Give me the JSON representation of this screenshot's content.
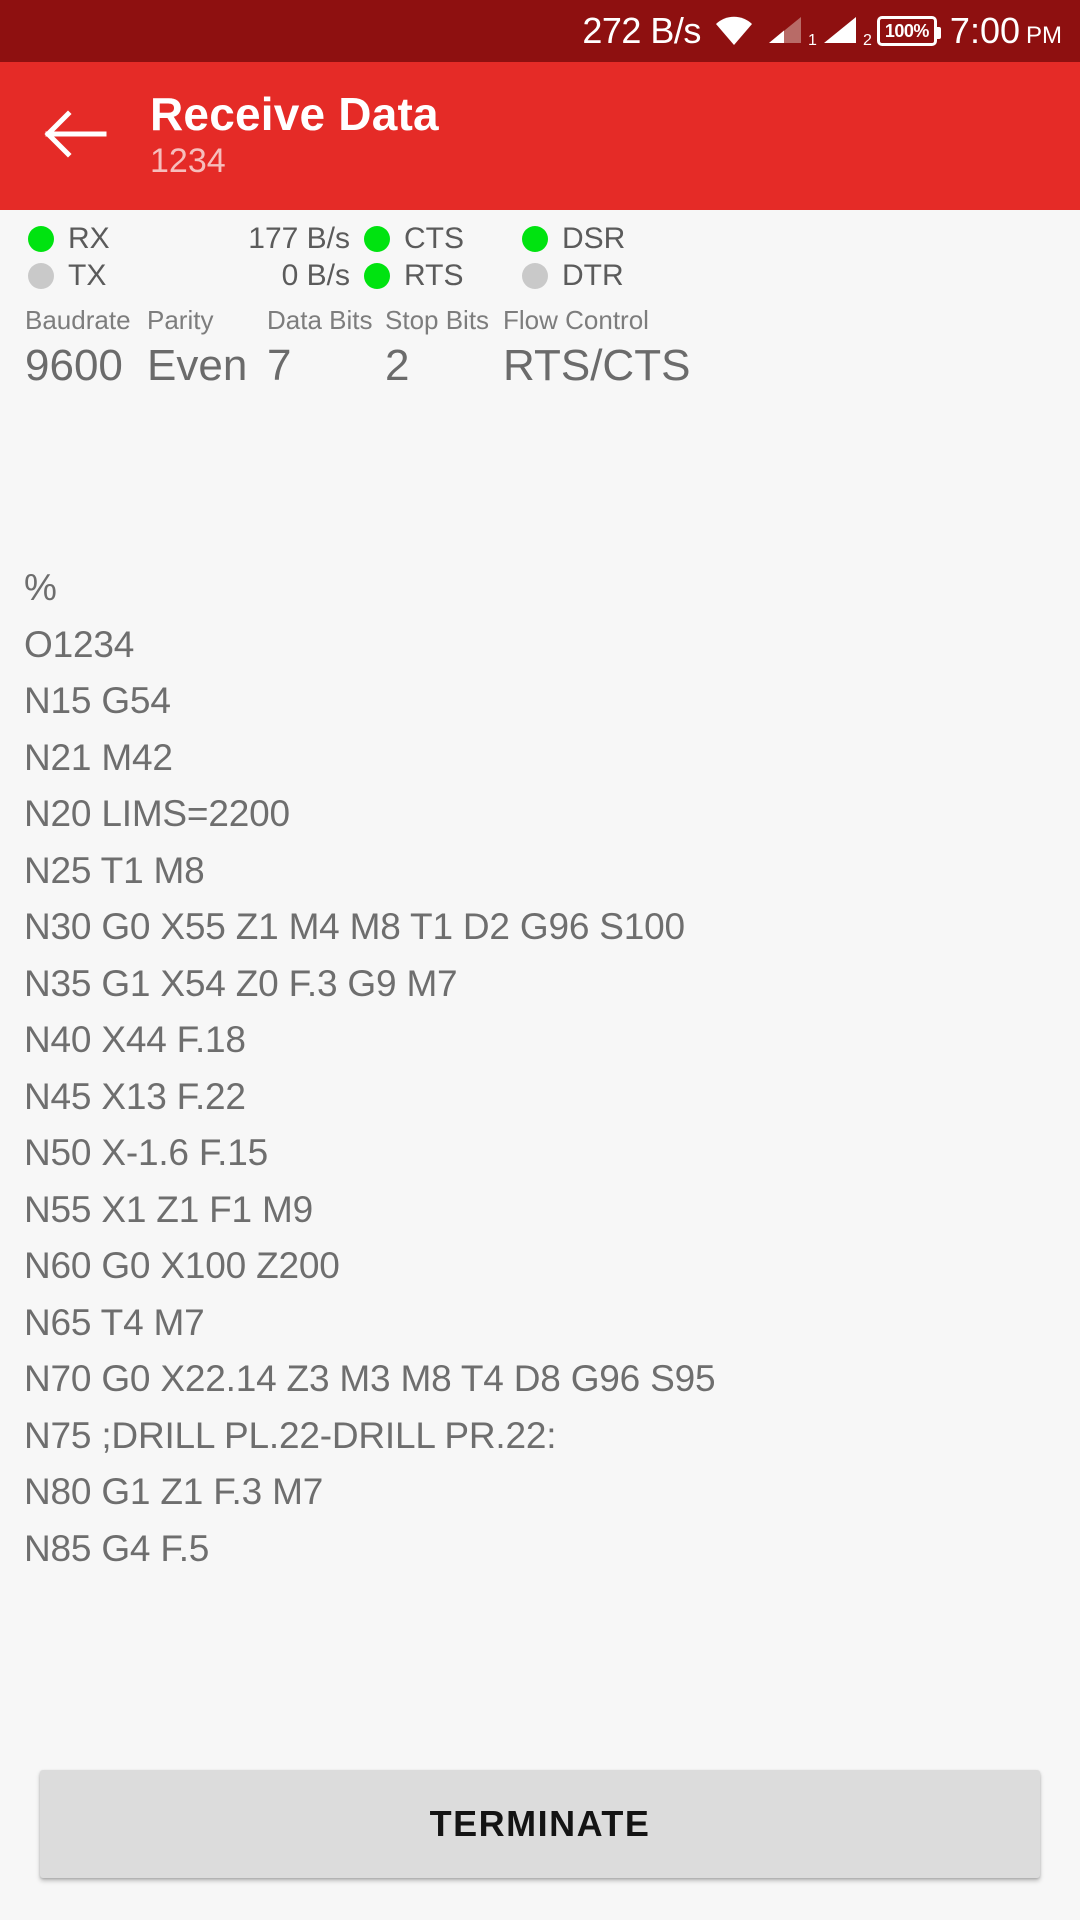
{
  "statusbar": {
    "net_speed": "272 B/s",
    "wifi_icon": "wifi-icon",
    "sim1_icon": "signal-sim1-icon",
    "sim1_label": "1",
    "sim2_icon": "signal-sim2-icon",
    "sim2_label": "2",
    "battery_text": "100%",
    "time": "7:00",
    "ampm": "PM"
  },
  "appbar": {
    "back_icon": "back-arrow-icon",
    "title": "Receive Data",
    "subtitle": "1234",
    "bg_color": "#E52B27"
  },
  "indicators": {
    "colors": {
      "on": "#00E310",
      "off": "#C9C9C9"
    },
    "rows": [
      {
        "signal_label": "RX",
        "signal_state": "on",
        "rate": "177 B/s",
        "mid_label": "CTS",
        "mid_state": "on",
        "end_label": "DSR",
        "end_state": "on"
      },
      {
        "signal_label": "TX",
        "signal_state": "off",
        "rate": "0 B/s",
        "mid_label": "RTS",
        "mid_state": "on",
        "end_label": "DTR",
        "end_state": "off"
      }
    ]
  },
  "settings": [
    {
      "label": "Baudrate",
      "value": "9600"
    },
    {
      "label": "Parity",
      "value": "Even"
    },
    {
      "label": "Data Bits",
      "value": "7"
    },
    {
      "label": "Stop Bits",
      "value": "2"
    },
    {
      "label": "Flow Control",
      "value": "RTS/CTS"
    }
  ],
  "terminal": {
    "lines": [
      "%",
      "O1234",
      "N15 G54",
      "N21 M42",
      "N20 LIMS=2200",
      "N25 T1 M8",
      "N30 G0 X55 Z1 M4 M8 T1 D2 G96 S100",
      "N35 G1 X54 Z0 F.3 G9 M7",
      "N40 X44 F.18",
      "N45 X13 F.22",
      "N50 X-1.6 F.15",
      "N55 X1 Z1 F1 M9",
      "N60 G0 X100 Z200",
      "N65 T4 M7",
      "N70 G0 X22.14 Z3 M3 M8 T4 D8 G96 S95",
      "N75 ;DRILL PL.22-DRILL PR.22:",
      "N80 G1 Z1 F.3 M7",
      "N85 G4 F.5"
    ]
  },
  "footer": {
    "terminate_label": "TERMINATE"
  }
}
